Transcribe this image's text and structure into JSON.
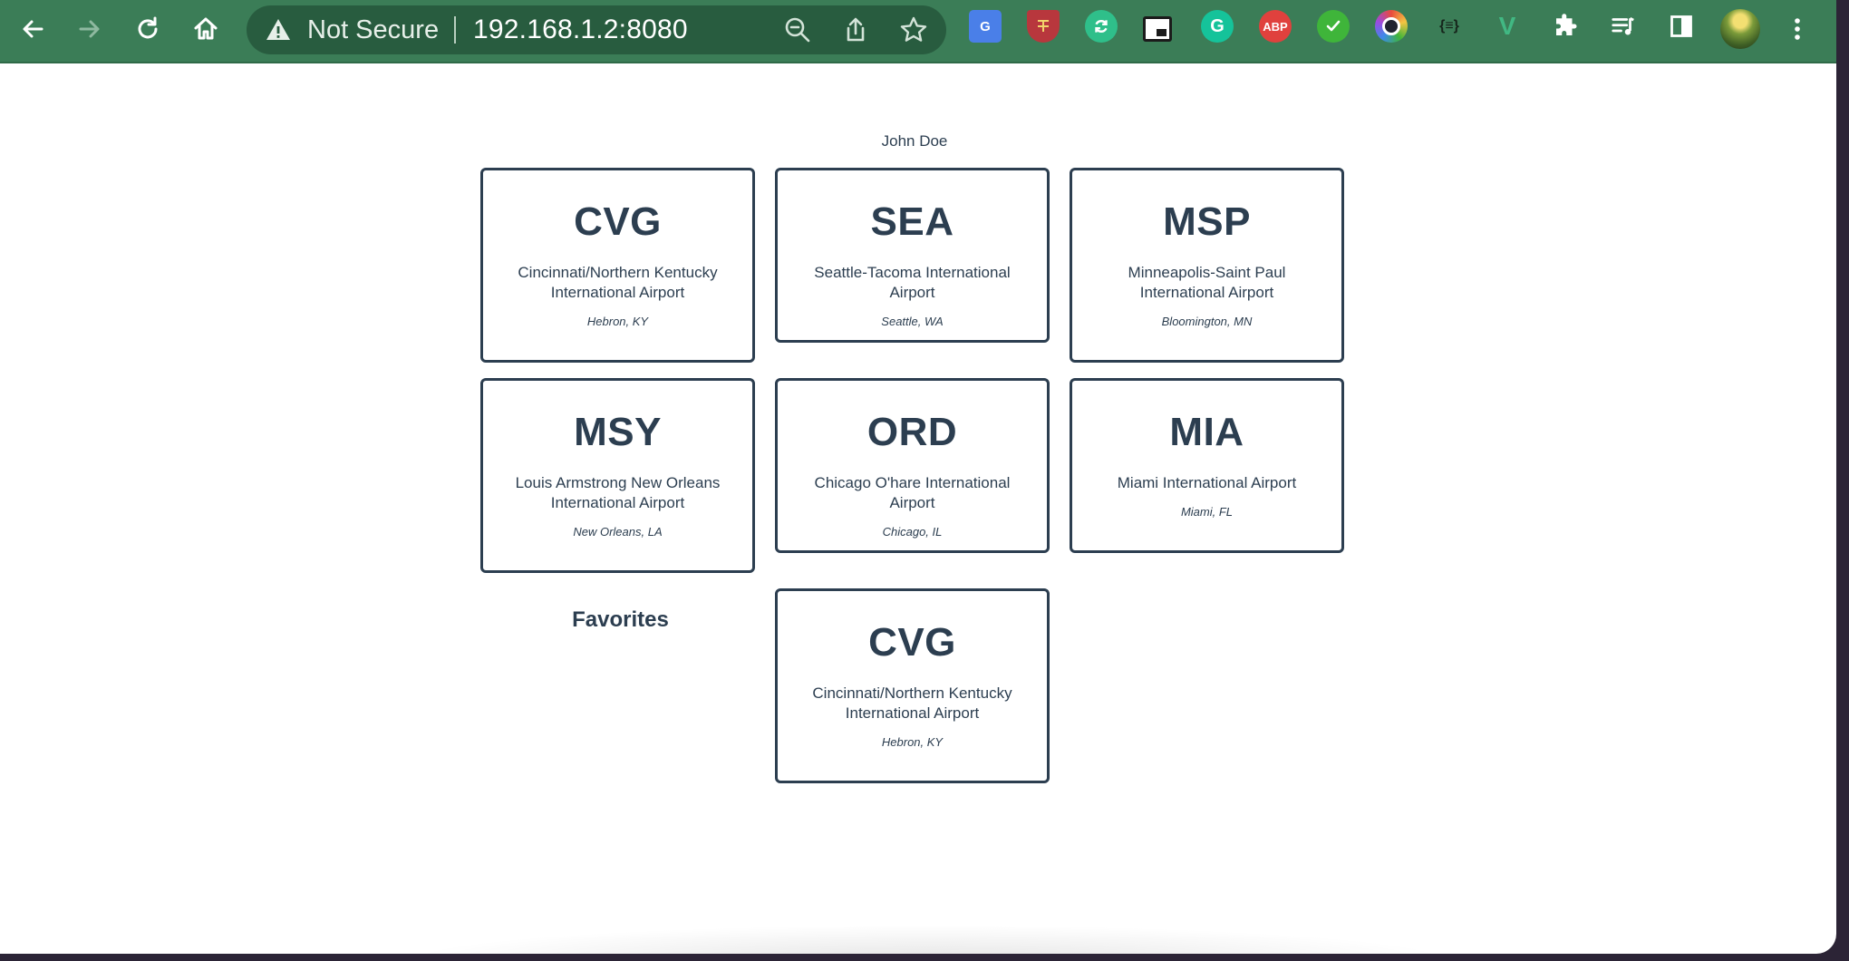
{
  "browser": {
    "security_label": "Not Secure",
    "url": "192.168.1.2:8080",
    "toolbar_color": "#3b7d57",
    "nav_icons": [
      "back-arrow-icon",
      "forward-arrow-icon",
      "reload-icon",
      "home-icon"
    ],
    "omnibox_icons": [
      "warning-icon",
      "zoom-out-icon",
      "share-icon",
      "bookmark-star-icon"
    ],
    "extensions": [
      {
        "name": "google-translate-icon",
        "label": "G",
        "color": "#4a7fe8"
      },
      {
        "name": "shield-crest-icon",
        "label": "",
        "color": "#b8373d"
      },
      {
        "name": "sync-extension-icon",
        "label": "",
        "color": "#2fbf8a"
      },
      {
        "name": "picture-in-picture-icon",
        "label": "",
        "color": "#ffffff"
      },
      {
        "name": "grammarly-icon",
        "label": "G",
        "color": "#15c39a"
      },
      {
        "name": "adblock-plus-icon",
        "label": "ABP",
        "color": "#e0413d"
      },
      {
        "name": "checkmark-extension-icon",
        "label": "",
        "color": "#3fb53a"
      },
      {
        "name": "color-picker-icon",
        "label": "",
        "color": "#7b4ae0"
      },
      {
        "name": "json-formatter-icon",
        "label": "{≡}",
        "color": "#2f6a48"
      },
      {
        "name": "vue-devtools-icon",
        "label": "V",
        "color": "#41b883"
      },
      {
        "name": "puzzle-extensions-icon",
        "label": "",
        "color": "#ffffff"
      },
      {
        "name": "reading-list-icon",
        "label": "",
        "color": "#ffffff"
      },
      {
        "name": "side-panel-icon",
        "label": "",
        "color": "#ffffff"
      }
    ]
  },
  "page": {
    "user_name": "John Doe",
    "text_color": "#2c3e50",
    "airports": [
      {
        "code": "CVG",
        "name": "Cincinnati/Northern Kentucky International Airport",
        "location": "Hebron, KY"
      },
      {
        "code": "SEA",
        "name": "Seattle-Tacoma International Airport",
        "location": "Seattle, WA"
      },
      {
        "code": "MSP",
        "name": "Minneapolis-Saint Paul International Airport",
        "location": "Bloomington, MN"
      },
      {
        "code": "MSY",
        "name": "Louis Armstrong New Orleans International Airport",
        "location": "New Orleans, LA"
      },
      {
        "code": "ORD",
        "name": "Chicago O'hare International Airport",
        "location": "Chicago, IL"
      },
      {
        "code": "MIA",
        "name": "Miami International Airport",
        "location": "Miami, FL"
      }
    ],
    "favorites_title": "Favorites",
    "favorites": [
      {
        "code": "CVG",
        "name": "Cincinnati/Northern Kentucky International Airport",
        "location": "Hebron, KY"
      }
    ]
  }
}
